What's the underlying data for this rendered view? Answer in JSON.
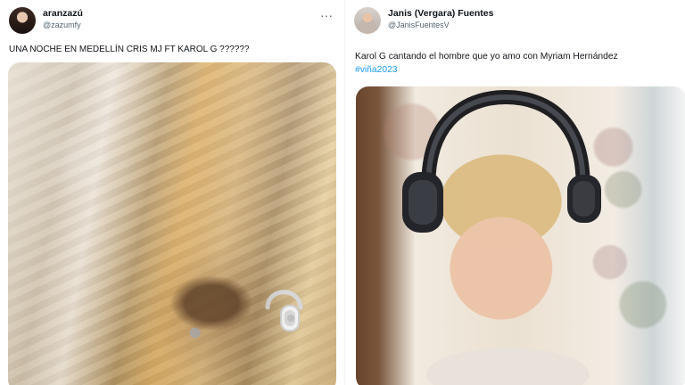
{
  "tweets": [
    {
      "display_name": "aranzazú",
      "handle": "@zazumfy",
      "text": "UNA NOCHE EN MEDELLÍN CRIS MJ FT KAROL G ??????",
      "more_label": "···",
      "media_icon": "headphones-icon"
    },
    {
      "display_name": "Janis (Vergara) Fuentes",
      "handle": "@JanisFuentesV",
      "text": "Karol G cantando el hombre que yo amo con Myriam Hernández",
      "hashtag": "#viña2023",
      "media_icon": "headphones-icon"
    }
  ],
  "colors": {
    "background": "#ffffff",
    "text": "#0f1419",
    "muted": "#536471",
    "link": "#1d9bf0"
  }
}
